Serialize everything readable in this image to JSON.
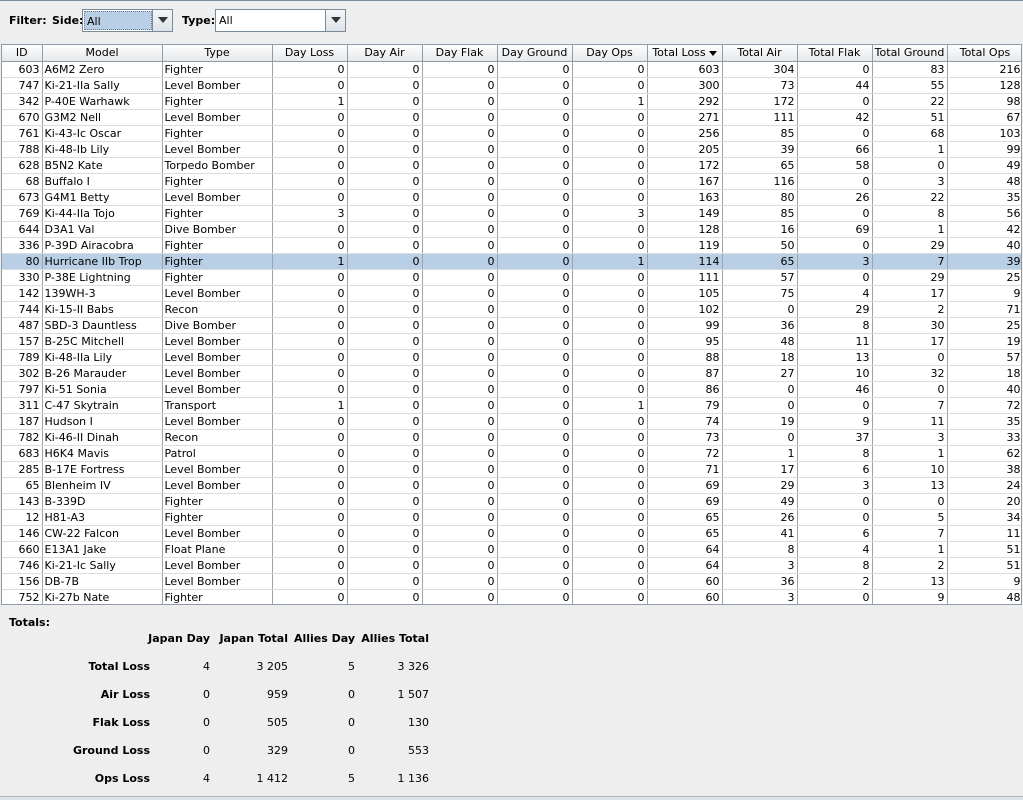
{
  "filter": {
    "label": "Filter:",
    "side_label": "Side:",
    "side_value": "All",
    "type_label": "Type:",
    "type_value": "All"
  },
  "table": {
    "columns": [
      "ID",
      "Model",
      "Type",
      "Day Loss",
      "Day Air",
      "Day Flak",
      "Day Ground",
      "Day Ops",
      "Total Loss",
      "Total Air",
      "Total Flak",
      "Total Ground",
      "Total Ops"
    ],
    "sorted_column": "Total Loss",
    "selected_row_index": 12,
    "rows": [
      [
        "603",
        "A6M2 Zero",
        "Fighter",
        "0",
        "0",
        "0",
        "0",
        "0",
        "603",
        "304",
        "0",
        "83",
        "216"
      ],
      [
        "747",
        "Ki-21-IIa Sally",
        "Level Bomber",
        "0",
        "0",
        "0",
        "0",
        "0",
        "300",
        "73",
        "44",
        "55",
        "128"
      ],
      [
        "342",
        "P-40E Warhawk",
        "Fighter",
        "1",
        "0",
        "0",
        "0",
        "1",
        "292",
        "172",
        "0",
        "22",
        "98"
      ],
      [
        "670",
        "G3M2 Nell",
        "Level Bomber",
        "0",
        "0",
        "0",
        "0",
        "0",
        "271",
        "111",
        "42",
        "51",
        "67"
      ],
      [
        "761",
        "Ki-43-Ic Oscar",
        "Fighter",
        "0",
        "0",
        "0",
        "0",
        "0",
        "256",
        "85",
        "0",
        "68",
        "103"
      ],
      [
        "788",
        "Ki-48-Ib Lily",
        "Level Bomber",
        "0",
        "0",
        "0",
        "0",
        "0",
        "205",
        "39",
        "66",
        "1",
        "99"
      ],
      [
        "628",
        "B5N2 Kate",
        "Torpedo Bomber",
        "0",
        "0",
        "0",
        "0",
        "0",
        "172",
        "65",
        "58",
        "0",
        "49"
      ],
      [
        "68",
        "Buffalo I",
        "Fighter",
        "0",
        "0",
        "0",
        "0",
        "0",
        "167",
        "116",
        "0",
        "3",
        "48"
      ],
      [
        "673",
        "G4M1 Betty",
        "Level Bomber",
        "0",
        "0",
        "0",
        "0",
        "0",
        "163",
        "80",
        "26",
        "22",
        "35"
      ],
      [
        "769",
        "Ki-44-IIa Tojo",
        "Fighter",
        "3",
        "0",
        "0",
        "0",
        "3",
        "149",
        "85",
        "0",
        "8",
        "56"
      ],
      [
        "644",
        "D3A1 Val",
        "Dive Bomber",
        "0",
        "0",
        "0",
        "0",
        "0",
        "128",
        "16",
        "69",
        "1",
        "42"
      ],
      [
        "336",
        "P-39D Airacobra",
        "Fighter",
        "0",
        "0",
        "0",
        "0",
        "0",
        "119",
        "50",
        "0",
        "29",
        "40"
      ],
      [
        "80",
        "Hurricane IIb Trop",
        "Fighter",
        "1",
        "0",
        "0",
        "0",
        "1",
        "114",
        "65",
        "3",
        "7",
        "39"
      ],
      [
        "330",
        "P-38E Lightning",
        "Fighter",
        "0",
        "0",
        "0",
        "0",
        "0",
        "111",
        "57",
        "0",
        "29",
        "25"
      ],
      [
        "142",
        "139WH-3",
        "Level Bomber",
        "0",
        "0",
        "0",
        "0",
        "0",
        "105",
        "75",
        "4",
        "17",
        "9"
      ],
      [
        "744",
        "Ki-15-II Babs",
        "Recon",
        "0",
        "0",
        "0",
        "0",
        "0",
        "102",
        "0",
        "29",
        "2",
        "71"
      ],
      [
        "487",
        "SBD-3 Dauntless",
        "Dive Bomber",
        "0",
        "0",
        "0",
        "0",
        "0",
        "99",
        "36",
        "8",
        "30",
        "25"
      ],
      [
        "157",
        "B-25C Mitchell",
        "Level Bomber",
        "0",
        "0",
        "0",
        "0",
        "0",
        "95",
        "48",
        "11",
        "17",
        "19"
      ],
      [
        "789",
        "Ki-48-IIa Lily",
        "Level Bomber",
        "0",
        "0",
        "0",
        "0",
        "0",
        "88",
        "18",
        "13",
        "0",
        "57"
      ],
      [
        "302",
        "B-26 Marauder",
        "Level Bomber",
        "0",
        "0",
        "0",
        "0",
        "0",
        "87",
        "27",
        "10",
        "32",
        "18"
      ],
      [
        "797",
        "Ki-51 Sonia",
        "Level Bomber",
        "0",
        "0",
        "0",
        "0",
        "0",
        "86",
        "0",
        "46",
        "0",
        "40"
      ],
      [
        "311",
        "C-47 Skytrain",
        "Transport",
        "1",
        "0",
        "0",
        "0",
        "1",
        "79",
        "0",
        "0",
        "7",
        "72"
      ],
      [
        "187",
        "Hudson I",
        "Level Bomber",
        "0",
        "0",
        "0",
        "0",
        "0",
        "74",
        "19",
        "9",
        "11",
        "35"
      ],
      [
        "782",
        "Ki-46-II Dinah",
        "Recon",
        "0",
        "0",
        "0",
        "0",
        "0",
        "73",
        "0",
        "37",
        "3",
        "33"
      ],
      [
        "683",
        "H6K4 Mavis",
        "Patrol",
        "0",
        "0",
        "0",
        "0",
        "0",
        "72",
        "1",
        "8",
        "1",
        "62"
      ],
      [
        "285",
        "B-17E Fortress",
        "Level Bomber",
        "0",
        "0",
        "0",
        "0",
        "0",
        "71",
        "17",
        "6",
        "10",
        "38"
      ],
      [
        "65",
        "Blenheim IV",
        "Level Bomber",
        "0",
        "0",
        "0",
        "0",
        "0",
        "69",
        "29",
        "3",
        "13",
        "24"
      ],
      [
        "143",
        "B-339D",
        "Fighter",
        "0",
        "0",
        "0",
        "0",
        "0",
        "69",
        "49",
        "0",
        "0",
        "20"
      ],
      [
        "12",
        "H81-A3",
        "Fighter",
        "0",
        "0",
        "0",
        "0",
        "0",
        "65",
        "26",
        "0",
        "5",
        "34"
      ],
      [
        "146",
        "CW-22 Falcon",
        "Level Bomber",
        "0",
        "0",
        "0",
        "0",
        "0",
        "65",
        "41",
        "6",
        "7",
        "11"
      ],
      [
        "660",
        "E13A1 Jake",
        "Float Plane",
        "0",
        "0",
        "0",
        "0",
        "0",
        "64",
        "8",
        "4",
        "1",
        "51"
      ],
      [
        "746",
        "Ki-21-Ic Sally",
        "Level Bomber",
        "0",
        "0",
        "0",
        "0",
        "0",
        "64",
        "3",
        "8",
        "2",
        "51"
      ],
      [
        "156",
        "DB-7B",
        "Level Bomber",
        "0",
        "0",
        "0",
        "0",
        "0",
        "60",
        "36",
        "2",
        "13",
        "9"
      ],
      [
        "752",
        "Ki-27b Nate",
        "Fighter",
        "0",
        "0",
        "0",
        "0",
        "0",
        "60",
        "3",
        "0",
        "9",
        "48"
      ]
    ]
  },
  "totals": {
    "title": "Totals:",
    "columns": [
      "Japan Day",
      "Japan Total",
      "Allies Day",
      "Allies Total"
    ],
    "rows": [
      {
        "label": "Total Loss",
        "values": [
          "4",
          "3 205",
          "5",
          "3 326"
        ]
      },
      {
        "label": "Air Loss",
        "values": [
          "0",
          "959",
          "0",
          "1 507"
        ]
      },
      {
        "label": "Flak Loss",
        "values": [
          "0",
          "505",
          "0",
          "130"
        ]
      },
      {
        "label": "Ground Loss",
        "values": [
          "0",
          "329",
          "0",
          "553"
        ]
      },
      {
        "label": "Ops Loss",
        "values": [
          "4",
          "1 412",
          "5",
          "1 136"
        ]
      }
    ]
  }
}
